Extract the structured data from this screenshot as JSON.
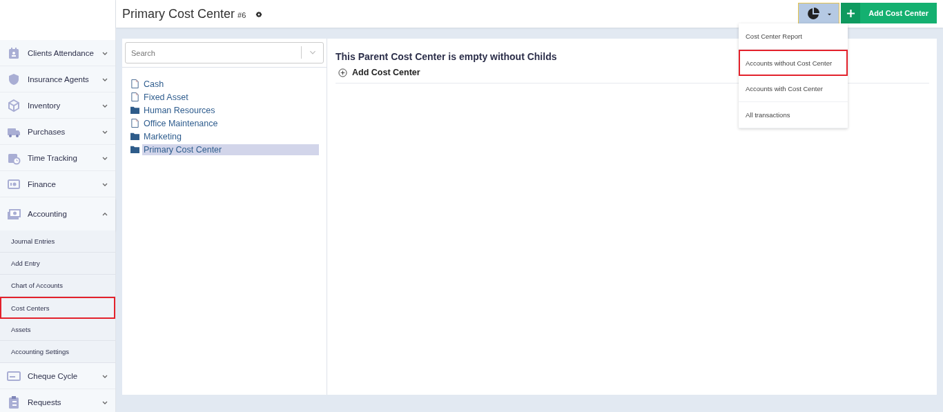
{
  "header": {
    "title": "Primary Cost Center",
    "number": "#6",
    "add_button": "Add Cost Center"
  },
  "sidebar": {
    "items": [
      {
        "label": "Clients Attendance",
        "expanded": false
      },
      {
        "label": "Insurance Agents",
        "expanded": false
      },
      {
        "label": "Inventory",
        "expanded": false
      },
      {
        "label": "Purchases",
        "expanded": false
      },
      {
        "label": "Time Tracking",
        "expanded": false
      },
      {
        "label": "Finance",
        "expanded": false
      },
      {
        "label": "Accounting",
        "expanded": true,
        "children": [
          {
            "label": "Journal Entries",
            "highlighted": false
          },
          {
            "label": "Add Entry",
            "highlighted": false
          },
          {
            "label": "Chart of Accounts",
            "highlighted": false
          },
          {
            "label": "Cost Centers",
            "highlighted": true
          },
          {
            "label": "Assets",
            "highlighted": false
          },
          {
            "label": "Accounting Settings",
            "highlighted": false
          }
        ]
      },
      {
        "label": "Cheque Cycle",
        "expanded": false
      },
      {
        "label": "Requests",
        "expanded": false
      }
    ]
  },
  "search": {
    "placeholder": "Search"
  },
  "tree": [
    {
      "label": "Cash",
      "kind": "file",
      "selected": false
    },
    {
      "label": "Fixed Asset",
      "kind": "file",
      "selected": false
    },
    {
      "label": "Human Resources",
      "kind": "folder",
      "selected": false
    },
    {
      "label": "Office Maintenance",
      "kind": "file",
      "selected": false
    },
    {
      "label": "Marketing",
      "kind": "folder",
      "selected": false
    },
    {
      "label": "Primary Cost Center",
      "kind": "folder",
      "selected": true
    }
  ],
  "detail": {
    "message": "This Parent Cost Center is empty without Childs",
    "add_link": "Add Cost Center"
  },
  "reports_menu": [
    {
      "label": "Cost Center Report",
      "highlighted": false
    },
    {
      "label": "Accounts without Cost Center",
      "highlighted": true
    },
    {
      "label": "Accounts with Cost Center",
      "highlighted": false
    },
    {
      "label": "All transactions",
      "highlighted": false
    }
  ]
}
